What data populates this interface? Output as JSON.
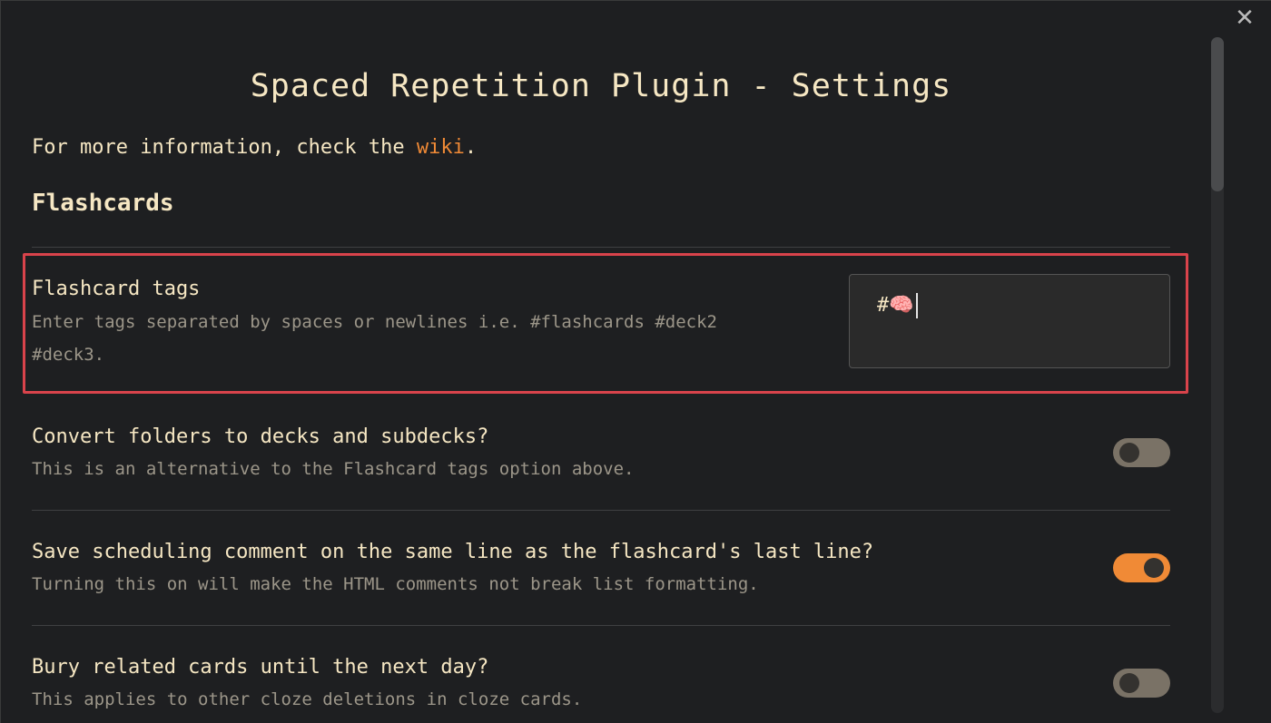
{
  "modal": {
    "close_glyph": "✕",
    "title": "Spaced Repetition Plugin - Settings",
    "info_prefix": "For more information, check the ",
    "info_link": "wiki",
    "info_suffix": "."
  },
  "section": {
    "heading": "Flashcards"
  },
  "settings": [
    {
      "name": "Flashcard tags",
      "desc_line1": "Enter tags separated by spaces or newlines i.e. #flashcards #deck2",
      "desc_line2": "#deck3.",
      "control": "textarea",
      "value": "#🧠"
    },
    {
      "name": "Convert folders to decks and subdecks?",
      "desc": "This is an alternative to the Flashcard tags option above.",
      "control": "toggle",
      "enabled": false
    },
    {
      "name": "Save scheduling comment on the same line as the flashcard's last line?",
      "desc": "Turning this on will make the HTML comments not break list formatting.",
      "control": "toggle",
      "enabled": true
    },
    {
      "name": "Bury related cards until the next day?",
      "desc": "This applies to other cloze deletions in cloze cards.",
      "control": "toggle",
      "enabled": false
    }
  ],
  "colors": {
    "accent": "#f08a36",
    "highlight_border": "#d9434b",
    "text": "#f6e7c3",
    "muted_text": "#9c9689",
    "background": "#1e1f21"
  }
}
